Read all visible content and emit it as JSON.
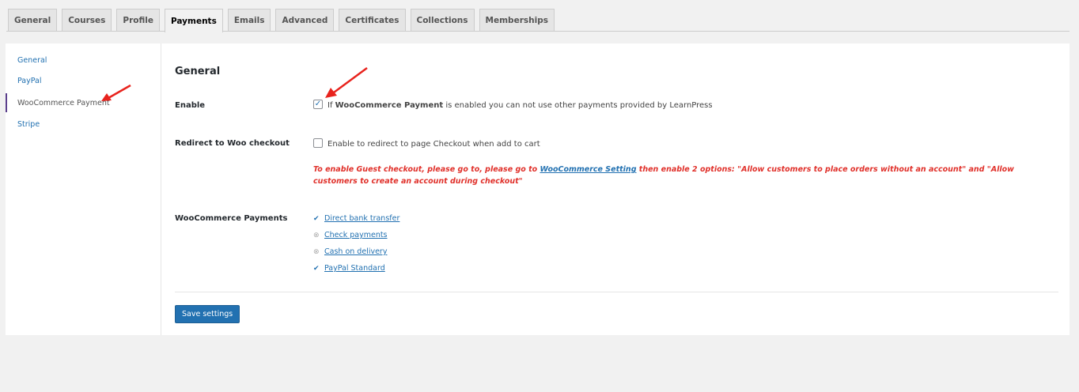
{
  "tabs": [
    "General",
    "Courses",
    "Profile",
    "Payments",
    "Emails",
    "Advanced",
    "Certificates",
    "Collections",
    "Memberships"
  ],
  "active_tab": "Payments",
  "sidenav": {
    "items": [
      "General",
      "PayPal",
      "WooCommerce Payment",
      "Stripe"
    ],
    "active": "WooCommerce Payment"
  },
  "section_title": "General",
  "enable": {
    "label": "Enable",
    "checked": true,
    "text_pre": "If ",
    "text_bold": "WooCommerce Payment",
    "text_post": " is enabled you can not use other payments provided by LearnPress"
  },
  "redirect": {
    "label": "Redirect to Woo checkout",
    "checked": false,
    "text": "Enable to redirect to page Checkout when add to cart"
  },
  "note": {
    "pre": "To enable Guest checkout, please go to, please go to ",
    "link": "WooCommerce Setting",
    "post": " then enable 2 options: \"Allow customers to place orders without an account\" and \"Allow customers to create an account during checkout\""
  },
  "woo_payments": {
    "label": "WooCommerce Payments",
    "items": [
      {
        "name": "Direct bank transfer",
        "status": "enabled"
      },
      {
        "name": "Check payments",
        "status": "disabled"
      },
      {
        "name": "Cash on delivery",
        "status": "disabled"
      },
      {
        "name": "PayPal Standard",
        "status": "enabled"
      }
    ]
  },
  "save_label": "Save settings",
  "colors": {
    "accent": "#2271b1",
    "note": "#e0302a",
    "arrow": "#e8231d"
  },
  "icons": {
    "checked": "check-icon",
    "disabled": "circle-x-icon"
  }
}
